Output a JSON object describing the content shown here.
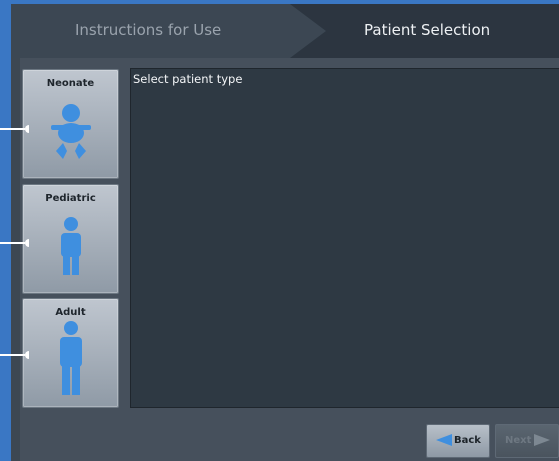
{
  "header": {
    "tabs": [
      {
        "label": "Instructions for Use",
        "state": "inactive"
      },
      {
        "label": "Patient Selection",
        "state": "active"
      }
    ]
  },
  "patient_types": [
    {
      "label": "Neonate",
      "icon": "neonate-icon"
    },
    {
      "label": "Pediatric",
      "icon": "child-icon"
    },
    {
      "label": "Adult",
      "icon": "adult-icon"
    }
  ],
  "content": {
    "prompt": "Select patient type"
  },
  "footer": {
    "back_label": "Back",
    "next_label": "Next",
    "next_enabled": false
  },
  "colors": {
    "accent": "#3a77c4",
    "figure": "#3f8fdf",
    "panel": "#2e3943"
  }
}
